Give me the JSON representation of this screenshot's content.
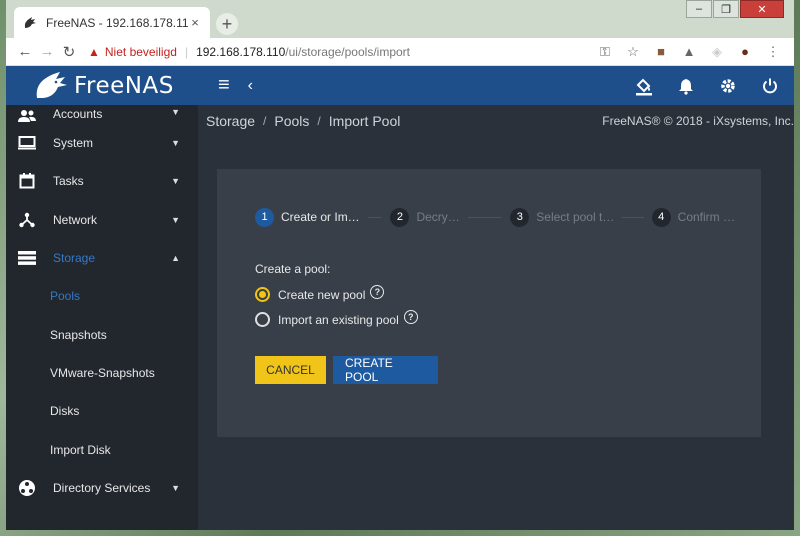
{
  "browser": {
    "tab_title": "FreeNAS - 192.168.178.110",
    "tab_close": "×",
    "new_tab": "+",
    "win_min": "–",
    "win_max": "❐",
    "win_close": "✕",
    "insecure_label": "Niet beveiligd",
    "url_host": "192.168.178.110",
    "url_path": "/ui/storage/pools/import"
  },
  "app": {
    "brand": "FreeNAS",
    "brand_color": "#1e4f8a"
  },
  "sidebar": {
    "items": [
      {
        "label": "Accounts",
        "icon": "people-icon"
      },
      {
        "label": "System",
        "icon": "monitor-icon"
      },
      {
        "label": "Tasks",
        "icon": "calendar-icon"
      },
      {
        "label": "Network",
        "icon": "network-icon"
      },
      {
        "label": "Storage",
        "icon": "storage-icon"
      }
    ],
    "storage_sub": [
      "Pools",
      "Snapshots",
      "VMware-Snapshots",
      "Disks",
      "Import Disk"
    ],
    "directory": {
      "label": "Directory Services",
      "icon": "directory-icon"
    }
  },
  "breadcrumb": {
    "items": [
      "Storage",
      "Pools",
      "Import Pool"
    ],
    "separator": "/",
    "copyright": "FreeNAS® © 2018 - iXsystems, Inc."
  },
  "wizard": {
    "steps": [
      {
        "num": "1",
        "label": "Create or Im…"
      },
      {
        "num": "2",
        "label": "Decry…"
      },
      {
        "num": "3",
        "label": "Select pool t…"
      },
      {
        "num": "4",
        "label": "Confirm …"
      }
    ],
    "form_label": "Create a pool:",
    "options": [
      {
        "label": "Create new pool",
        "checked": true
      },
      {
        "label": "Import an existing pool",
        "checked": false
      }
    ],
    "help_glyph": "?",
    "cancel_label": "CANCEL",
    "create_label": "CREATE POOL",
    "accent_yellow": "#f0c419",
    "accent_blue": "#1e5aa0"
  }
}
